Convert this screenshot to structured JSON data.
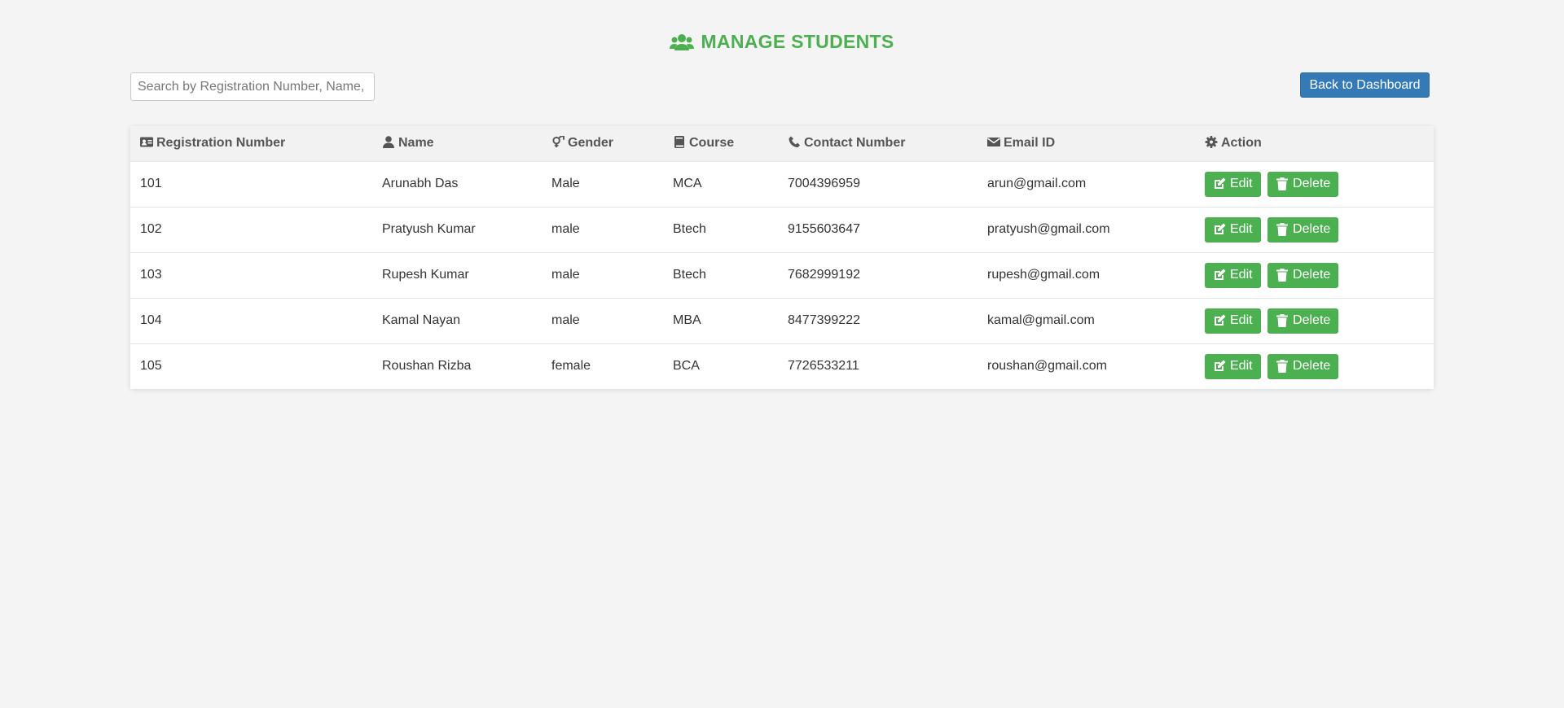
{
  "header": {
    "title": "MANAGE STUDENTS",
    "icon": "users-icon",
    "color": "#4caf50"
  },
  "search": {
    "placeholder": "Search by Registration Number, Name, Gender, Course, Contact or Email",
    "value": ""
  },
  "toolbar": {
    "back_label": "Back to Dashboard",
    "back_color": "#337ab7"
  },
  "table": {
    "columns": [
      {
        "label": "Registration Number",
        "icon": "id-card-icon"
      },
      {
        "label": "Name",
        "icon": "user-icon"
      },
      {
        "label": "Gender",
        "icon": "gender-icon"
      },
      {
        "label": "Course",
        "icon": "book-icon"
      },
      {
        "label": "Contact Number",
        "icon": "phone-icon"
      },
      {
        "label": "Email ID",
        "icon": "envelope-icon"
      },
      {
        "label": "Action",
        "icon": "gear-icon"
      }
    ],
    "edit_label": "Edit",
    "delete_label": "Delete",
    "rows": [
      {
        "reg": "101",
        "name": "Arunabh Das",
        "gender": "Male",
        "course": "MCA",
        "contact": "7004396959",
        "email": "arun@gmail.com"
      },
      {
        "reg": "102",
        "name": "Pratyush Kumar",
        "gender": "male",
        "course": "Btech",
        "contact": "9155603647",
        "email": "pratyush@gmail.com"
      },
      {
        "reg": "103",
        "name": "Rupesh Kumar",
        "gender": "male",
        "course": "Btech",
        "contact": "7682999192",
        "email": "rupesh@gmail.com"
      },
      {
        "reg": "104",
        "name": "Kamal Nayan",
        "gender": "male",
        "course": "MBA",
        "contact": "8477399222",
        "email": "kamal@gmail.com"
      },
      {
        "reg": "105",
        "name": "Roushan Rizba",
        "gender": "female",
        "course": "BCA",
        "contact": "7726533211",
        "email": "roushan@gmail.com"
      }
    ]
  }
}
